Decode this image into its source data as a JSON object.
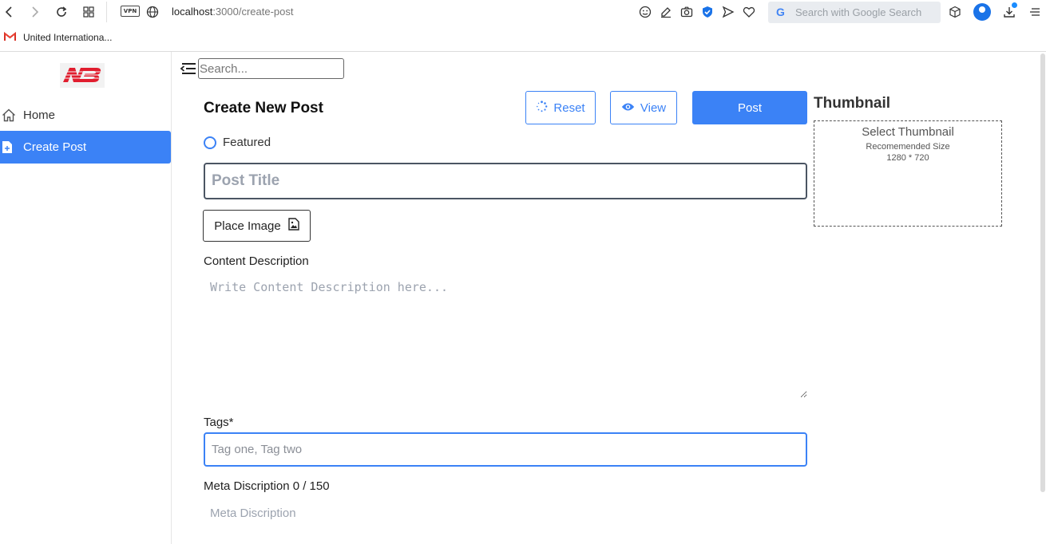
{
  "browser": {
    "url_host": "localhost",
    "url_path": ":3000/create-post",
    "vpn_label": "VPN",
    "search_placeholder": "Search with Google Search",
    "google_letter": "G",
    "bookmark_label": "United Internationa...",
    "bookmark_icon": "gmail-icon"
  },
  "sidebar": {
    "logo": "brand-logo",
    "items": [
      {
        "label": "Home",
        "icon": "home-icon",
        "active": false
      },
      {
        "label": "Create Post",
        "icon": "file-plus-icon",
        "active": true
      }
    ]
  },
  "topbar": {
    "search_placeholder": "Search..."
  },
  "form": {
    "title": "Create New Post",
    "buttons": {
      "reset": "Reset",
      "view": "View",
      "post": "Post"
    },
    "featured_label": "Featured",
    "post_title_placeholder": "Post Title",
    "place_image_label": "Place Image",
    "content_label": "Content Description",
    "content_placeholder": "Write Content Description here...",
    "tags_label": "Tags*",
    "tags_placeholder": "Tag one, Tag two",
    "meta_label": "Meta Discription 0 / 150",
    "meta_placeholder": "Meta Discription"
  },
  "thumbnail": {
    "title": "Thumbnail",
    "select_label": "Select Thumbnail",
    "size_label": "Recomemended Size",
    "size_value": "1280 * 720"
  },
  "colors": {
    "accent": "#3b82f6",
    "brand_red": "#e11d2e"
  }
}
